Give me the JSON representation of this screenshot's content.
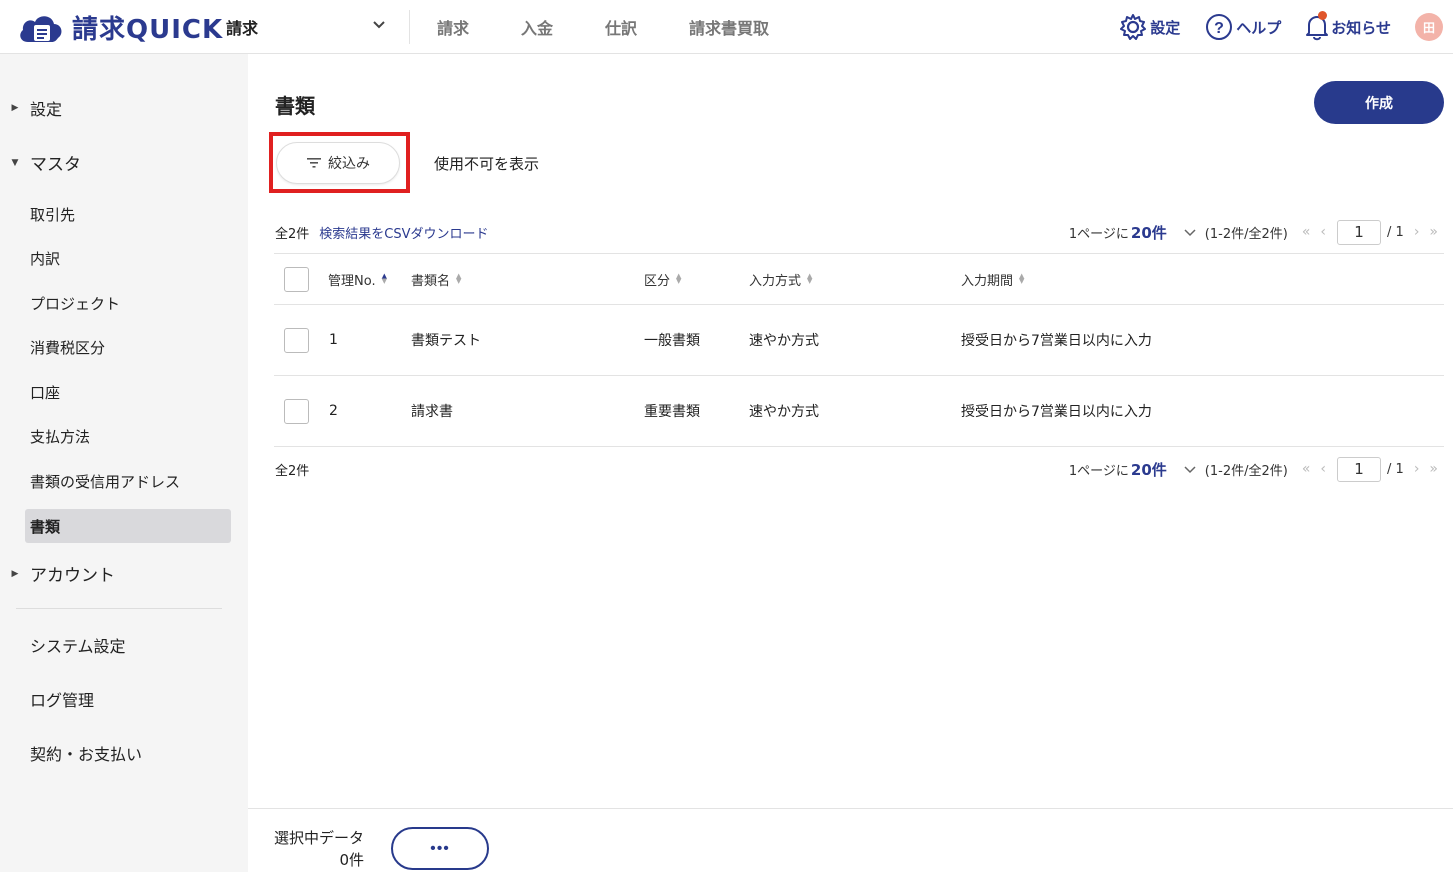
{
  "app": {
    "logo_text": "請求QUICK"
  },
  "header": {
    "product": "請求",
    "nav": [
      "請求",
      "入金",
      "仕訳",
      "請求書買取"
    ],
    "settings": "設定",
    "help": "ヘルプ",
    "notices": "お知らせ",
    "avatar": "田"
  },
  "sidebar": {
    "settings_group": "設定",
    "master_group": "マスタ",
    "master_items": [
      "取引先",
      "内訳",
      "プロジェクト",
      "消費税区分",
      "口座",
      "支払方法",
      "書類の受信用アドレス",
      "書類"
    ],
    "active_item": "書類",
    "account_group": "アカウント",
    "system_settings": "システム設定",
    "log_management": "ログ管理",
    "contract": "契約・お支払い"
  },
  "main": {
    "title": "書類",
    "create_label": "作成",
    "filter_label": "絞込み",
    "show_unusable": "使用不可を表示",
    "total_top": "全2件",
    "csv_link": "検索結果をCSVダウンロード",
    "total_bottom": "全2件",
    "pager": {
      "per_page_prefix": "1ページに",
      "per_page_value": "20件",
      "range": "(1-2件/全2件)",
      "page": "1",
      "pages": "/ 1"
    },
    "table": {
      "headers": [
        "管理No.",
        "書類名",
        "区分",
        "入力方式",
        "入力期間"
      ],
      "rows": [
        {
          "no": "1",
          "name": "書類テスト",
          "category": "一般書類",
          "method": "速やか方式",
          "period": "授受日から7営業日以内に入力"
        },
        {
          "no": "2",
          "name": "請求書",
          "category": "重要書類",
          "method": "速やか方式",
          "period": "授受日から7営業日以内に入力"
        }
      ]
    },
    "footer": {
      "selected_label": "選択中データ",
      "selected_count": "0件",
      "more": "•••"
    }
  },
  "colors": {
    "brand": "#283a8c",
    "highlight": "#e02020",
    "sidebar_bg": "#f5f5f5"
  }
}
